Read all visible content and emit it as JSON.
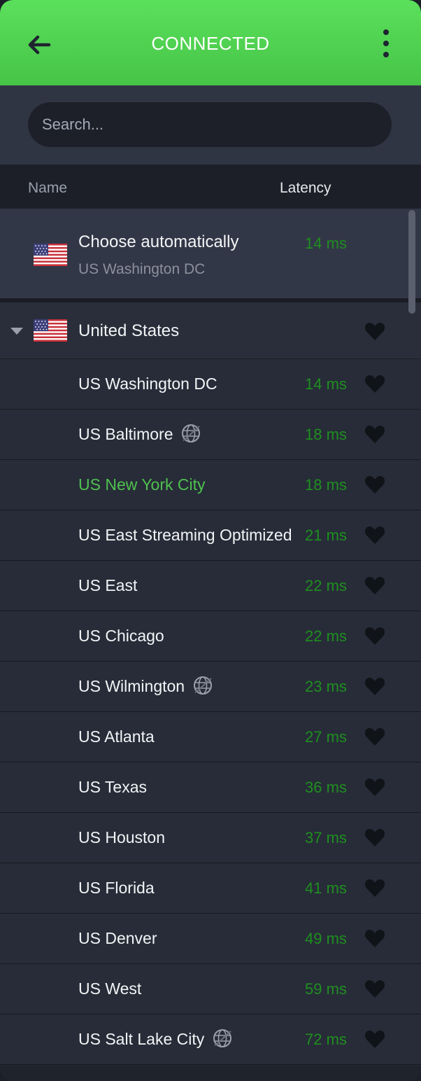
{
  "header": {
    "title": "CONNECTED",
    "back_icon": "arrow-left-icon",
    "menu_icon": "more-vertical-icon",
    "color": "#52d653"
  },
  "search": {
    "placeholder": "Search...",
    "value": ""
  },
  "columns": {
    "name": "Name",
    "latency": "Latency"
  },
  "auto": {
    "title": "Choose automatically",
    "subtitle": "US Washington DC",
    "latency": "14 ms",
    "flag_icon": "us-flag-icon"
  },
  "country": {
    "name": "United States",
    "flag_icon": "us-flag-icon",
    "expanded": true
  },
  "servers": [
    {
      "name": "US Washington DC",
      "latency": "14 ms",
      "icon": null,
      "active": false
    },
    {
      "name": "US Baltimore",
      "latency": "18 ms",
      "icon": "globe-icon",
      "active": false
    },
    {
      "name": "US New York City",
      "latency": "18 ms",
      "icon": null,
      "active": true
    },
    {
      "name": "US East Streaming Optimized",
      "latency": "21 ms",
      "icon": null,
      "active": false
    },
    {
      "name": "US East",
      "latency": "22 ms",
      "icon": null,
      "active": false
    },
    {
      "name": "US Chicago",
      "latency": "22 ms",
      "icon": null,
      "active": false
    },
    {
      "name": "US Wilmington",
      "latency": "23 ms",
      "icon": "globe-icon",
      "active": false
    },
    {
      "name": "US Atlanta",
      "latency": "27 ms",
      "icon": null,
      "active": false
    },
    {
      "name": "US Texas",
      "latency": "36 ms",
      "icon": null,
      "active": false
    },
    {
      "name": "US Houston",
      "latency": "37 ms",
      "icon": null,
      "active": false
    },
    {
      "name": "US Florida",
      "latency": "41 ms",
      "icon": null,
      "active": false
    },
    {
      "name": "US Denver",
      "latency": "49 ms",
      "icon": null,
      "active": false
    },
    {
      "name": "US West",
      "latency": "59 ms",
      "icon": null,
      "active": false
    },
    {
      "name": "US Salt Lake City",
      "latency": "72 ms",
      "icon": "globe-icon",
      "active": false
    }
  ],
  "colors": {
    "latency": "#1f8f1f",
    "active_server": "#4fc04f",
    "background": "#262b36"
  }
}
